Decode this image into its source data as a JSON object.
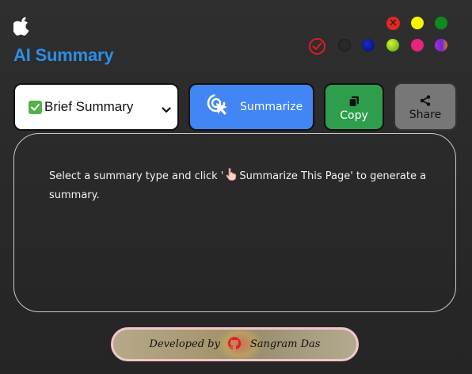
{
  "app": {
    "title": "AI Summary",
    "logo_icon": "apple-icon"
  },
  "theme_swatches": {
    "close_glyph": "✕",
    "top_row": [
      {
        "name": "close",
        "color": "#e32626"
      },
      {
        "name": "yellow",
        "color": "#f5f500"
      },
      {
        "name": "green",
        "color": "#0f8b1e"
      }
    ],
    "bottom_row": [
      {
        "name": "selected-check",
        "color": "#e01c1c"
      },
      {
        "name": "dark",
        "color": "#2a2a2a"
      },
      {
        "name": "navy",
        "color": "#0a1a9a"
      },
      {
        "name": "lime",
        "color": "#7dcc1a"
      },
      {
        "name": "pink",
        "color": "#e8247a"
      },
      {
        "name": "purple-orange",
        "color": "#8a2bd6"
      }
    ]
  },
  "controls": {
    "summary_type": {
      "selected": "Brief Summary",
      "icon": "checkbox-check-icon"
    },
    "summarize_label": "Summarize",
    "summarize_icon": "cursor-click-icon",
    "copy_label": "Copy",
    "copy_icon": "copy-icon",
    "share_label": "Share",
    "share_icon": "share-icon"
  },
  "output": {
    "text_before": "Select a summary type and click '",
    "text_pointer_icon": "pointing-hand-icon",
    "text_after": "Summarize This Page' to generate a summary."
  },
  "footer": {
    "developed_by": "Developed by",
    "github_icon": "github-icon",
    "author": "Sangram Das"
  },
  "colors": {
    "accent_blue": "#4285f4",
    "title_blue": "#2d8ee6",
    "copy_green": "#2e9e4d",
    "share_gray": "#777777",
    "background": "#2a2a2a"
  }
}
